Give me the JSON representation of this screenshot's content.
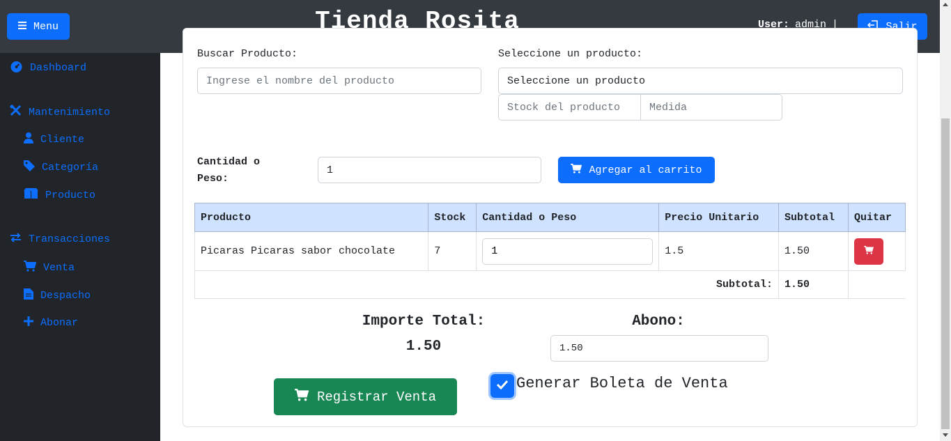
{
  "header": {
    "menu_label": "Menu",
    "brand": "Tienda Rosita",
    "user_prefix": "User:",
    "user_name": "admin",
    "separator": "|",
    "logout_label": "Salir"
  },
  "sidebar": {
    "dashboard": "Dashboard",
    "mantenimiento": "Mantenimiento",
    "cliente": "Cliente",
    "categoria": "Categoría",
    "producto": "Producto",
    "transacciones": "Transacciones",
    "venta": "Venta",
    "despacho": "Despacho",
    "abonar": "Abonar"
  },
  "form": {
    "search_label": "Buscar Producto:",
    "search_placeholder": "Ingrese el nombre del producto",
    "select_label": "Seleccione un producto:",
    "select_value": "Seleccione un producto",
    "stock_placeholder": "Stock del producto",
    "medida_placeholder": "Medida",
    "qty_label_line1": "Cantidad o",
    "qty_label_line2": "Peso:",
    "qty_value": "1",
    "add_button": "Agregar al carrito"
  },
  "table": {
    "headers": [
      "Producto",
      "Stock",
      "Cantidad o Peso",
      "Precio Unitario",
      "Subtotal",
      "Quitar"
    ],
    "rows": [
      {
        "producto": "Picaras Picaras sabor chocolate",
        "stock": "7",
        "cantidad": "1",
        "precio": "1.5",
        "subtotal": "1.50"
      }
    ],
    "subtotal_label": "Subtotal:",
    "subtotal_value": "1.50"
  },
  "totals": {
    "importe_label": "Importe Total:",
    "importe_value": "1.50",
    "abono_label": "Abono:",
    "abono_value": "1.50"
  },
  "actions": {
    "register_button": "Registrar Venta",
    "boleta_label": "Generar Boleta de Venta",
    "boleta_checked": true
  },
  "colors": {
    "primary": "#0d6efd",
    "danger": "#dc3545",
    "success": "#198754",
    "topbar": "#343a40",
    "sidebar": "#212529",
    "table_header": "#cfe2ff"
  }
}
